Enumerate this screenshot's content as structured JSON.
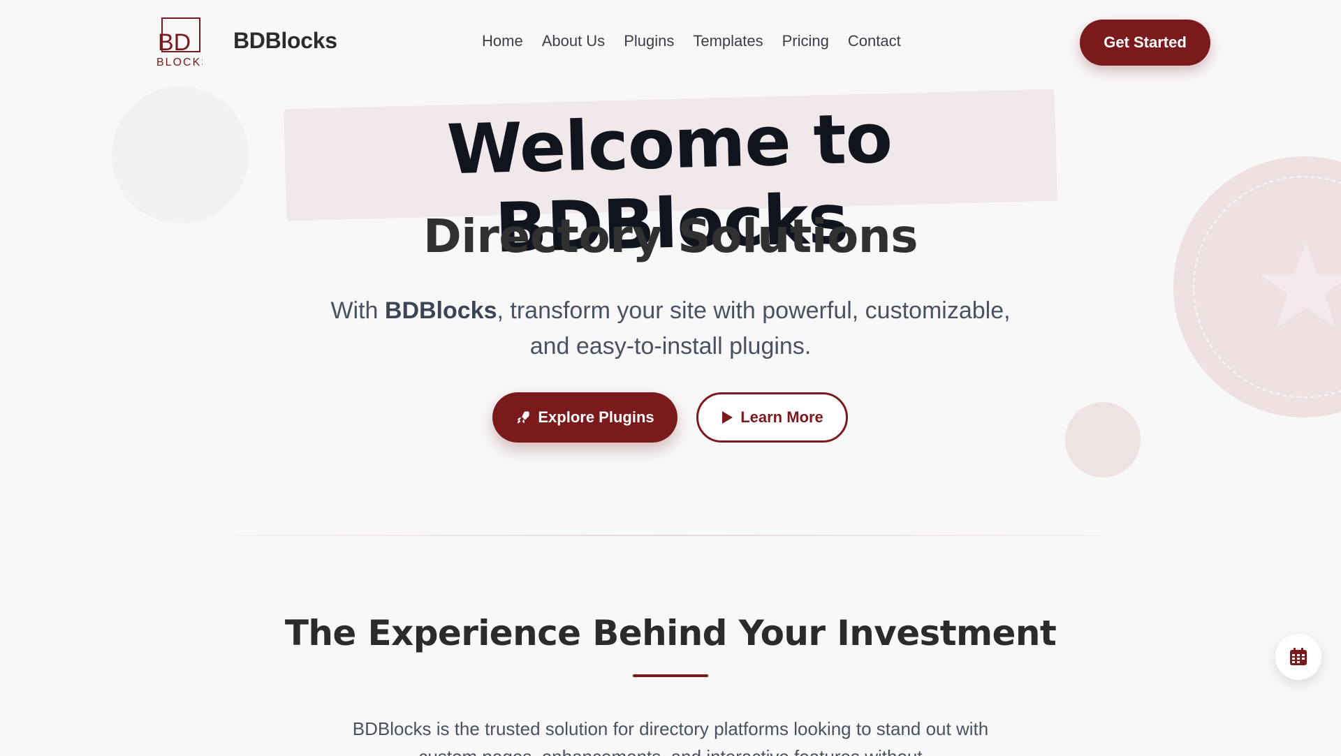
{
  "header": {
    "brand": "BDBlocks",
    "logo_text_top": "BD",
    "logo_text_bottom": "BLOCKS",
    "nav": [
      "Home",
      "About Us",
      "Plugins",
      "Templates",
      "Pricing",
      "Contact"
    ],
    "cta_label": "Get Started"
  },
  "hero": {
    "title": "Welcome to BDBlocks",
    "subtitle": "Directory Solutions",
    "desc_prefix": "With ",
    "desc_brand": "BDBlocks",
    "desc_rest": ", transform your site with powerful, customizable, and easy-to-install plugins.",
    "primary_button": "Explore Plugins",
    "primary_icon": "rocket-icon",
    "secondary_button": "Learn More",
    "secondary_icon": "play-icon"
  },
  "section": {
    "title": "The Experience Behind Your Investment",
    "text": "BDBlocks is the trusted solution for directory platforms looking to stand out with custom pages, enhancements, and interactive features without"
  },
  "fab": {
    "icon": "calendar-icon"
  },
  "colors": {
    "accent": "#7b1a1c",
    "background": "#f8f8f9",
    "title": "#10141f"
  }
}
